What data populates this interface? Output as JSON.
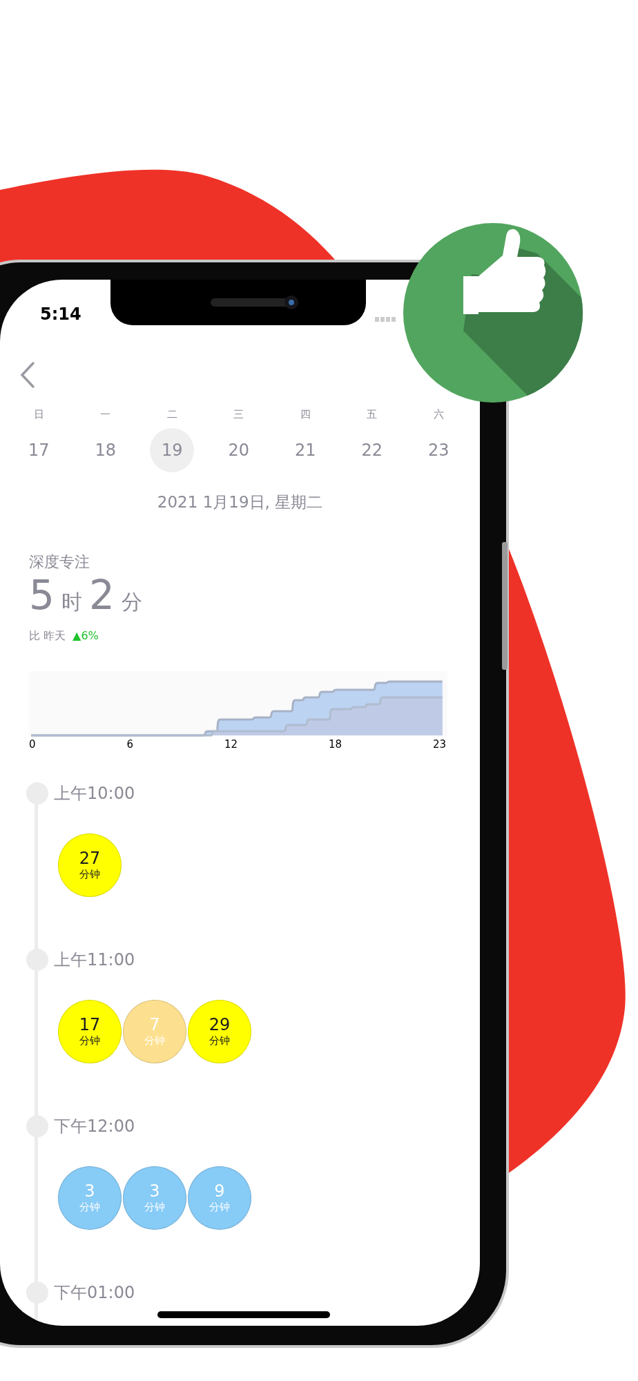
{
  "status_bar": {
    "time": "5:14"
  },
  "week": {
    "weekdays": [
      "日",
      "一",
      "二",
      "三",
      "四",
      "五",
      "六"
    ],
    "days": [
      {
        "label": "17",
        "selected": false
      },
      {
        "label": "18",
        "selected": false
      },
      {
        "label": "19",
        "selected": true
      },
      {
        "label": "20",
        "selected": false
      },
      {
        "label": "21",
        "selected": false
      },
      {
        "label": "22",
        "selected": false
      },
      {
        "label": "23",
        "selected": false
      }
    ]
  },
  "date_title": "2021 1月19日, 星期二",
  "summary": {
    "title": "深度专注",
    "hours": "5",
    "hours_unit": "时",
    "minutes": "2",
    "minutes_unit": "分",
    "compare_label": "比 昨天",
    "change": "▲6%"
  },
  "chart": {
    "axis_labels": [
      "0",
      "6",
      "12",
      "18",
      "23"
    ]
  },
  "timeline": [
    {
      "time": "上午10:00",
      "sessions": [
        {
          "minutes": "27",
          "unit": "分钟",
          "color": "#ffff00"
        }
      ]
    },
    {
      "time": "上午11:00",
      "sessions": [
        {
          "minutes": "17",
          "unit": "分钟",
          "color": "#ffff00"
        },
        {
          "minutes": "7",
          "unit": "分钟",
          "color": "#fde08f"
        },
        {
          "minutes": "29",
          "unit": "分钟",
          "color": "#ffff00"
        }
      ]
    },
    {
      "time": "下午12:00",
      "sessions": [
        {
          "minutes": "3",
          "unit": "分钟",
          "color": "#87cbf7"
        },
        {
          "minutes": "3",
          "unit": "分钟",
          "color": "#87cbf7"
        },
        {
          "minutes": "9",
          "unit": "分钟",
          "color": "#87cbf7"
        }
      ]
    },
    {
      "time": "下午01:00"
    }
  ]
}
